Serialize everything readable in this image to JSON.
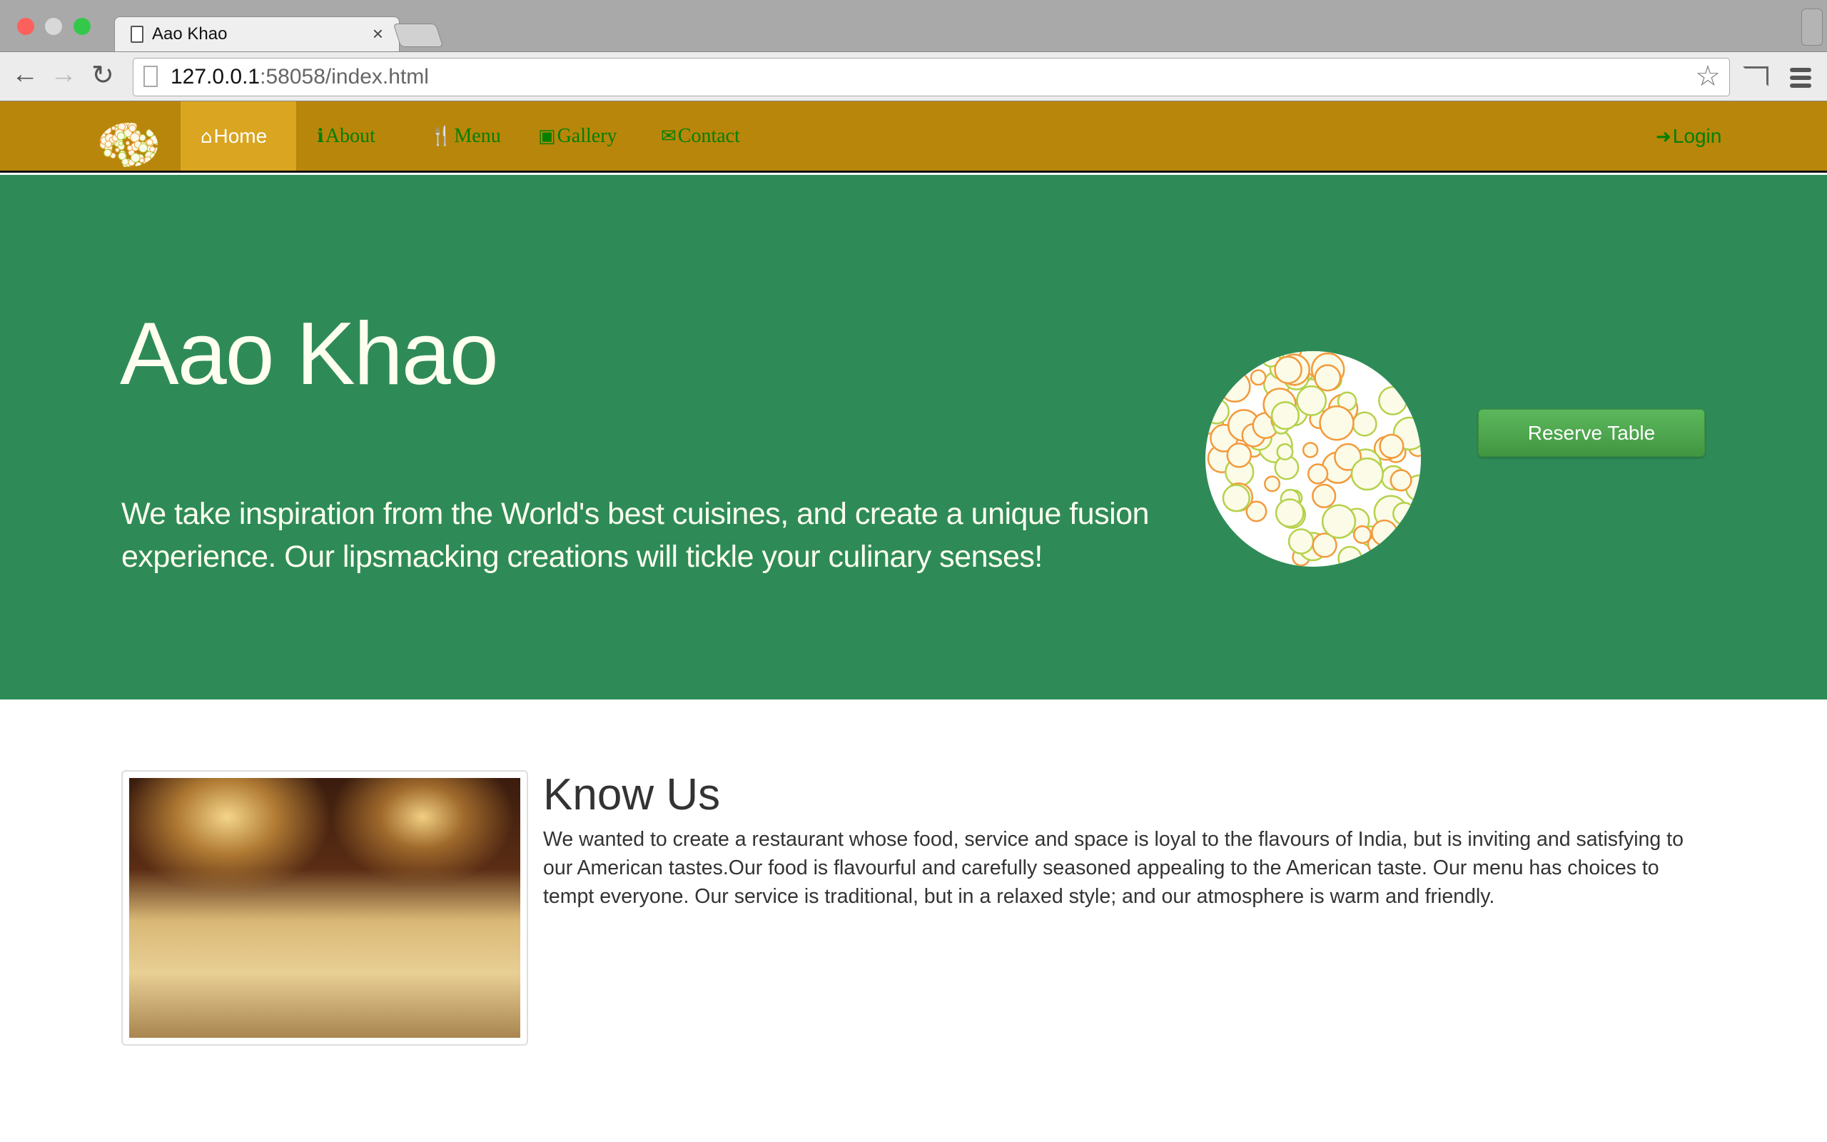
{
  "browser": {
    "tab_title": "Aao Khao",
    "close": "×",
    "url_host": "127.0.0.1",
    "url_rest": ":58058/index.html",
    "back": "←",
    "forward": "→",
    "reload": "↻",
    "star": "☆"
  },
  "nav": {
    "items": [
      {
        "label": "Home",
        "icon": "⌂"
      },
      {
        "label": "About",
        "icon": "ℹ"
      },
      {
        "label": "Menu",
        "icon": "🍴"
      },
      {
        "label": "Gallery",
        "icon": "▣"
      },
      {
        "label": "Contact",
        "icon": "✉"
      }
    ],
    "login": {
      "label": "Login",
      "icon": "➜"
    }
  },
  "hero": {
    "title": "Aao Khao",
    "text": "We take inspiration from the World's best cuisines, and create a unique fusion experience. Our lipsmacking creations will tickle your culinary senses!",
    "button": "Reserve Table"
  },
  "know": {
    "title": "Know Us",
    "text": "We wanted to create a restaurant whose food, service and space is loyal to the flavours of India, but is inviting and satisfying to our American tastes.Our food is flavourful and carefully seasoned appealing to the American taste. Our menu has choices to tempt everyone. Our service is traditional, but in a relaxed style; and our atmosphere is warm and friendly."
  },
  "colors": {
    "nav": "#b8860b",
    "active": "#daa520",
    "hero": "#2e8b57",
    "link": "#008000"
  }
}
